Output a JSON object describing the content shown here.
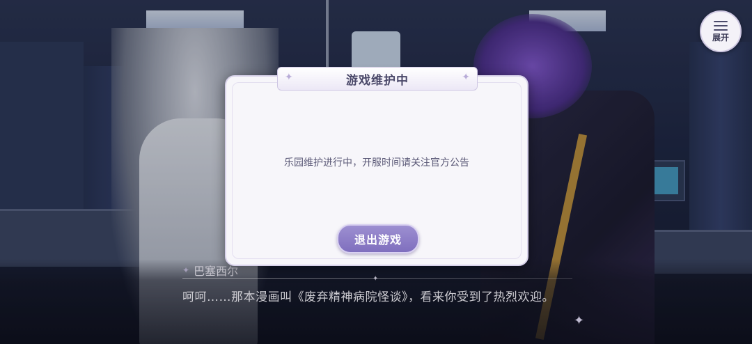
{
  "menu": {
    "label": "展开",
    "icon": "hamburger-menu-icon"
  },
  "modal": {
    "title": "游戏维护中",
    "message": "乐园维护进行中，开服时间请关注官方公告",
    "exit_button": "退出游戏"
  },
  "dialog": {
    "speaker": "巴塞西尔",
    "text": "呵呵……那本漫画叫《废弃精神病院怪谈》，看来你受到了热烈欢迎。"
  },
  "colors": {
    "modal_bg": "#f7f6fa",
    "button_purple": "#8f80c8",
    "title_text": "#4a4869",
    "scene_bg": "#1d2640"
  }
}
